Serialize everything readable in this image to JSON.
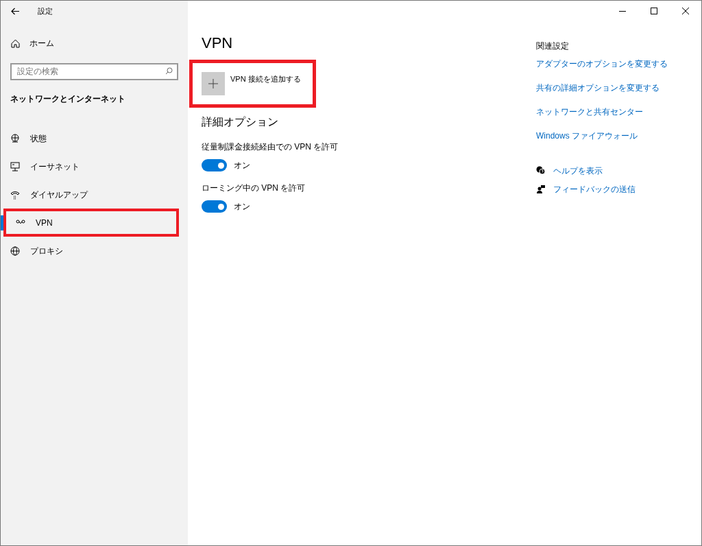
{
  "window": {
    "title": "設定"
  },
  "sidebar": {
    "home": "ホーム",
    "search": {
      "placeholder": "設定の検索"
    },
    "section": "ネットワークとインターネット",
    "items": [
      {
        "label": "状態",
        "selected": false,
        "highlighted": false
      },
      {
        "label": "イーサネット",
        "selected": false,
        "highlighted": false
      },
      {
        "label": "ダイヤルアップ",
        "selected": false,
        "highlighted": false
      },
      {
        "label": "VPN",
        "selected": true,
        "highlighted": true
      },
      {
        "label": "プロキシ",
        "selected": false,
        "highlighted": false
      }
    ]
  },
  "main": {
    "title": "VPN",
    "add_button": {
      "label": "VPN 接続を追加する",
      "highlighted": true
    },
    "advanced_heading": "詳細オプション",
    "toggles": [
      {
        "label": "従量制課金接続経由での VPN を許可",
        "on": true,
        "state_text": "オン"
      },
      {
        "label": "ローミング中の VPN を許可",
        "on": true,
        "state_text": "オン"
      }
    ]
  },
  "related": {
    "heading": "関連設定",
    "links": [
      "アダプターのオプションを変更する",
      "共有の詳細オプションを変更する",
      "ネットワークと共有センター",
      "Windows ファイアウォール"
    ],
    "help": [
      {
        "label": "ヘルプを表示"
      },
      {
        "label": "フィードバックの送信"
      }
    ]
  }
}
